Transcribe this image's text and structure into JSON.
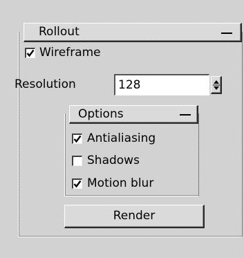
{
  "rollout": {
    "title": "Rollout",
    "collapse_symbol": "—"
  },
  "wireframe": {
    "label": "Wireframe",
    "checked": true
  },
  "resolution": {
    "label": "Resolution",
    "value": "128"
  },
  "options": {
    "title": "Options",
    "items": [
      {
        "label": "Antialiasing",
        "checked": true
      },
      {
        "label": "Shadows",
        "checked": false
      },
      {
        "label": "Motion blur",
        "checked": true
      }
    ]
  },
  "render_button": {
    "label": "Render"
  }
}
